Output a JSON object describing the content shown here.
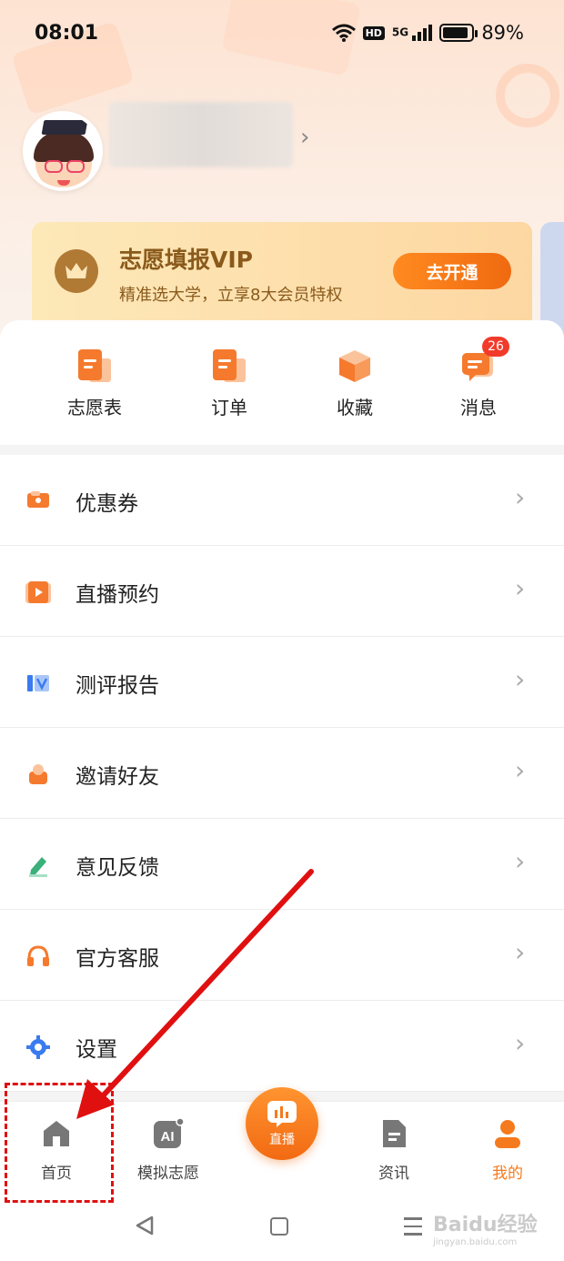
{
  "status_bar": {
    "time": "08:01",
    "hd": "HD",
    "signal": "5G",
    "battery": "89%",
    "battery_level": 0.89
  },
  "profile": {
    "chevron": "›"
  },
  "vip": {
    "title": "志愿填报VIP",
    "subtitle": "精准选大学，立享8大会员特权",
    "button": "去开通",
    "icon": "crown-icon"
  },
  "quick_actions": [
    {
      "label": "志愿表",
      "icon": "document-icon"
    },
    {
      "label": "订单",
      "icon": "order-icon"
    },
    {
      "label": "收藏",
      "icon": "box-icon"
    },
    {
      "label": "消息",
      "icon": "message-icon",
      "badge": "26"
    }
  ],
  "menu": [
    {
      "label": "优惠券",
      "icon": "coupon-icon"
    },
    {
      "label": "直播预约",
      "icon": "live-play-icon"
    },
    {
      "label": "测评报告",
      "icon": "report-icon"
    },
    {
      "label": "邀请好友",
      "icon": "invite-user-icon"
    },
    {
      "label": "意见反馈",
      "icon": "edit-icon"
    },
    {
      "label": "官方客服",
      "icon": "headphones-icon"
    },
    {
      "label": "设置",
      "icon": "gear-icon"
    }
  ],
  "bottom_nav": {
    "home": "首页",
    "mock": "模拟志愿",
    "live": "直播",
    "news": "资讯",
    "mine": "我的"
  },
  "watermark": {
    "text": "Baidu经验",
    "sub": "jingyan.baidu.com"
  },
  "colors": {
    "accent": "#f57a1e",
    "vip_text": "#8a5a1c",
    "annotation": "#e01010"
  }
}
